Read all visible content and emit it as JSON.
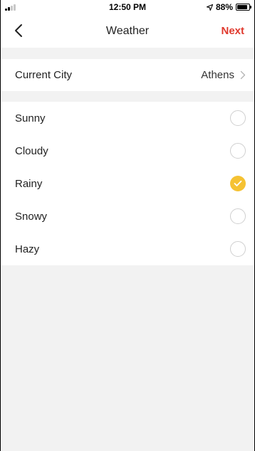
{
  "status_bar": {
    "time": "12:50 PM",
    "battery_text": "88%",
    "battery_level": 0.88,
    "location_icon": "location-arrow-icon"
  },
  "nav": {
    "title": "Weather",
    "back_icon": "chevron-left-icon",
    "next_label": "Next",
    "next_color": "#e03a2e"
  },
  "city": {
    "label": "Current City",
    "value": "Athens",
    "chevron_icon": "chevron-right-icon"
  },
  "weather_options": [
    {
      "label": "Sunny",
      "selected": false
    },
    {
      "label": "Cloudy",
      "selected": false
    },
    {
      "label": "Rainy",
      "selected": true
    },
    {
      "label": "Snowy",
      "selected": false
    },
    {
      "label": "Hazy",
      "selected": false
    }
  ],
  "colors": {
    "accent": "#f5c233",
    "background": "#f2f2f2"
  }
}
